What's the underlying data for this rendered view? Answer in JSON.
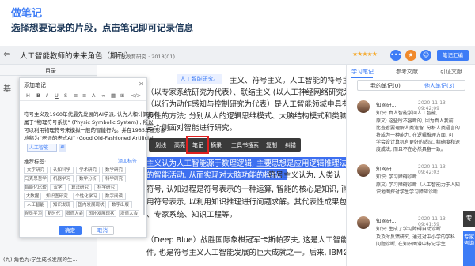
{
  "header": {
    "title": "做笔记",
    "subtitle": "选择想要记录的片段，点击笔记即可记录信息"
  },
  "toolbar": {
    "back_icon": "arrow-left-icon",
    "doc_title": "人工智能教师的未来角色（期刊）",
    "source": "开放教育研究 · 2018(01)",
    "rating": "★★★★★",
    "note_button": "笔记汇编",
    "accent": "#3d7cf6"
  },
  "left_panel": {
    "tab": "目录",
    "lines": [
      "基",
      "（",
      "（",
      "（",
      "（",
      "（",
      "（",
      "（",
      "（",
      "（",
      "（",
      "（",
      "（",
      "(九) 角色九:学生成长发展的生..."
    ]
  },
  "document": {
    "keyword": "人工智能研究。",
    "lines": [
      "主义、符号主义。人工智能的符号主义 (以基于知识",
      "（以专家系统研究为代表）、联结主义 (以人工神经网络研究为代表) 、",
      "（以行为动作感知与控制研究为代表）是人工智能领域中具有代",
      "表性的方法; 分别从人的逻辑思维模式、大脑结构模式和类脑智能",
      "三个侧面对智能进行研究。"
    ],
    "hl1": "主义认为人工智能源于数理逻辑, 主要思想是应用逻辑推理法则",
    "hl2": "的智能活动, 从而实现对大脑功能的模拟。",
    "after_hl2": "符号主义认为, 人类认",
    "lines2": [
      "符号, 认知过程是符号表示的一种运算, 智能的核心是知识, 而",
      "用符号表示, 以利用知识推理进行问题求解。其代表性成果包括",
      "、专家系统、知识工程等。",
      "（Deep Blue）战胜国际象棋冠军卡斯帕罗夫, 这是人工智能的里程碑事",
      "件, 也是符号主义人工智能发展的巨大成就之一。后来, IBM公司推出认知系"
    ],
    "context_menu": [
      "划线",
      "高亮",
      "笔记",
      "摘录",
      "工具书搜索",
      "复制",
      "纠错"
    ],
    "copy_badge": "复制"
  },
  "popup": {
    "title": "添加笔记",
    "tools": [
      "H",
      "B",
      "I",
      "U",
      "S",
      "≡",
      "≡",
      "A",
      "∞",
      "▦",
      "⊞",
      "</>"
    ],
    "text": [
      "符号主义及1960年代最先发展的AI学派, 认为人和计算机均",
      "属于“物理符号系统” (Physic Symbolic System) , 所以",
      "可以利用物理符号来模拟一般的智能行为。并在1985年被形象",
      "地称为“老派的老式AI” (Good Old-Fashioned Artificial"
    ],
    "tag": "人工智能",
    "tag_ai": "AI",
    "rec_label": "推荐标签:",
    "add_label": "添加标签",
    "chips": [
      [
        "文字研究",
        "认知科学",
        "学术研究",
        "数学研究"
      ],
      [
        "马克思哲学",
        "机器学习",
        "数学分析",
        "科学研究"
      ],
      [
        "智能化比较",
        "汉学",
        "算法研究",
        "科学研究"
      ],
      [
        "大数据",
        "知识图研究",
        "个性化学习",
        "数字阅读"
      ],
      [
        "人工智能",
        "知识发现",
        "国内发展现状",
        "数字出版"
      ],
      [
        "党员学习",
        "新时代",
        "增值大会",
        "国外发展现状",
        "增值大会"
      ],
      [
        "党员学习",
        "新时代",
        "增值大会",
        "国外发展现状",
        "增值大会"
      ]
    ],
    "ok": "确定",
    "cancel": "取消"
  },
  "right_panel": {
    "tabs": [
      "学习笔记",
      "参考文献",
      "引证文献"
    ],
    "sub": [
      "我的笔记(0)",
      "他人笔记(3)"
    ],
    "cards": [
      {
        "name": "知网研...",
        "date": "2020-11-13 09:42:09",
        "lines": [
          "知识: 真人智能学问人工智能,",
          "原文: 这些所不容断的, 因为真人我前",
          "比查看要理解人类遗留, 分析人类语言的",
          "将成为一种能力, 在逻辑推理方面, 可",
          "学会设计算机有更好的适应, 精确度和速",
          "度成法, 而且不在必然具备一致。",
          "编辑"
        ]
      },
      {
        "name": "知网研...",
        "date": "2020-11-13 09:42:03",
        "lines": [
          "知识: 学习障碍诊断",
          "原文: 学习障碍诊断（人工智能力于人知",
          "识地图探讨学生学习障碍诊断...",
          "编辑"
        ]
      },
      {
        "name": "知网研...",
        "date": "2020-11-13 09:41:59",
        "lines": [
          "知识: 生成了学习障碍自动诊断",
          "及及时反馈研究, 通过对中小学的学科",
          "问题诊断, 在知识图谱中标记学生"
        ]
      }
    ],
    "side_buttons": [
      "专",
      "专家咨询"
    ]
  }
}
